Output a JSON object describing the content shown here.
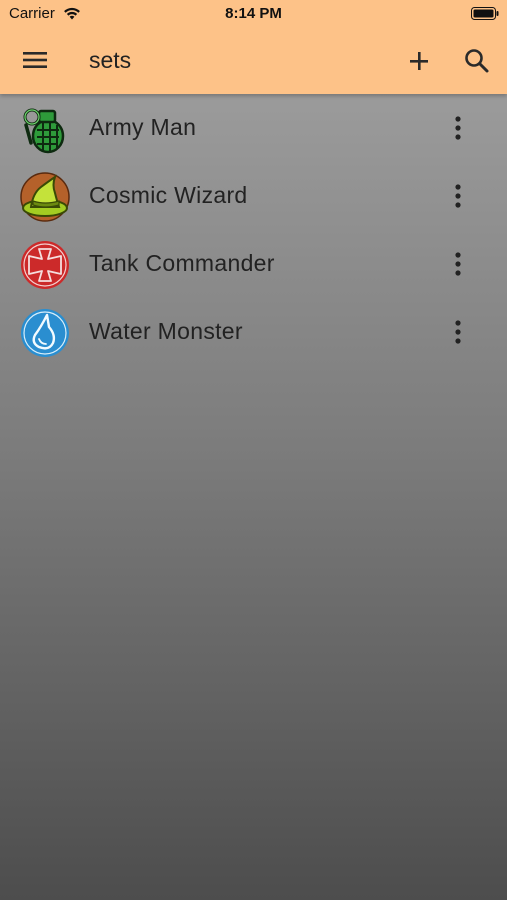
{
  "status_bar": {
    "carrier": "Carrier",
    "time": "8:14 PM",
    "wifi_icon": "wifi-icon",
    "battery_icon": "battery-icon"
  },
  "toolbar": {
    "title": "sets",
    "menu_icon": "hamburger-menu-icon",
    "add_icon": "plus-icon",
    "search_icon": "search-icon",
    "background_color": "#FDC288"
  },
  "sets": [
    {
      "label": "Army Man",
      "icon": "grenade-icon",
      "icon_color": "#2E9B3A"
    },
    {
      "label": "Cosmic Wizard",
      "icon": "wizard-hat-icon",
      "icon_color": "#A4CC22"
    },
    {
      "label": "Tank Commander",
      "icon": "iron-cross-icon",
      "icon_color": "#CC2A2A"
    },
    {
      "label": "Water Monster",
      "icon": "water-drop-icon",
      "icon_color": "#2A8ED0"
    }
  ],
  "item_menu_icon": "more-vertical-icon"
}
